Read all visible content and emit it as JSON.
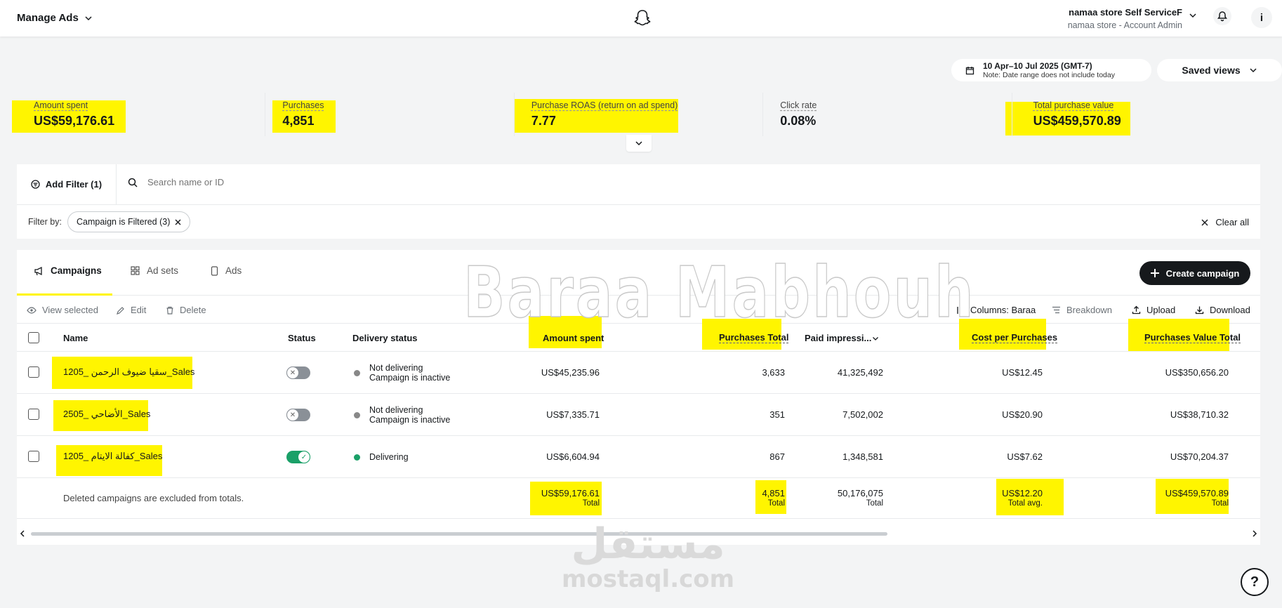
{
  "header": {
    "app_title": "Manage Ads",
    "account_name": "namaa store Self ServiceF",
    "account_role": "namaa store - Account Admin",
    "info_label": "i"
  },
  "date_range": {
    "label": "10 Apr–10 Jul 2025 (GMT-7)",
    "note": "Note: Date range does not include today"
  },
  "saved_views_label": "Saved views",
  "kpis": [
    {
      "label": "Amount spent",
      "value": "US$59,176.61"
    },
    {
      "label": "Purchases",
      "value": "4,851"
    },
    {
      "label": "Purchase ROAS (return on ad spend)",
      "value": "7.77"
    },
    {
      "label": "Click rate",
      "value": "0.08%"
    },
    {
      "label": "Total purchase value",
      "value": "US$459,570.89"
    }
  ],
  "filters": {
    "add_filter_label": "Add Filter (1)",
    "search_placeholder": "Search name or ID",
    "filter_by_label": "Filter by:",
    "chip_label": "Campaign is Filtered (3)",
    "clear_all_label": "Clear all"
  },
  "tabs": [
    {
      "label": "Campaigns"
    },
    {
      "label": "Ad sets"
    },
    {
      "label": "Ads"
    }
  ],
  "create_campaign_label": "Create campaign",
  "toolbar": {
    "view_selected": "View selected",
    "edit": "Edit",
    "delete": "Delete",
    "columns": "Columns: Baraa",
    "breakdown": "Breakdown",
    "upload": "Upload",
    "download": "Download"
  },
  "table": {
    "headers": {
      "name": "Name",
      "status": "Status",
      "delivery_status": "Delivery status",
      "amount_spent": "Amount spent",
      "purchases_total": "Purchases Total",
      "paid_impressions": "Paid impressi...",
      "cost_per_purchases": "Cost per Purchases",
      "purchases_value_total": "Purchases Value Total"
    },
    "rows": [
      {
        "name": "سقيا ضيوف الرحمن _1205_Sales",
        "delivery_main": "Not delivering",
        "delivery_sub": "Campaign is inactive",
        "amount_spent": "US$45,235.96",
        "purchases": "3,633",
        "impressions": "41,325,492",
        "cost_per": "US$12.45",
        "value_total": "US$350,656.20"
      },
      {
        "name": "الأضاحي _2505_Sales",
        "delivery_main": "Not delivering",
        "delivery_sub": "Campaign is inactive",
        "amount_spent": "US$7,335.71",
        "purchases": "351",
        "impressions": "7,502,002",
        "cost_per": "US$20.90",
        "value_total": "US$38,710.32"
      },
      {
        "name": "كفالة الايتام _1205_Sales",
        "delivery_main": "Delivering",
        "delivery_sub": "",
        "amount_spent": "US$6,604.94",
        "purchases": "867",
        "impressions": "1,348,581",
        "cost_per": "US$7.62",
        "value_total": "US$70,204.37"
      }
    ],
    "totals": {
      "note": "Deleted campaigns are excluded from totals.",
      "amount_spent": "US$59,176.61",
      "amount_spent_sub": "Total",
      "purchases": "4,851",
      "purchases_sub": "Total",
      "impressions": "50,176,075",
      "impressions_sub": "Total",
      "cost_per": "US$12.20",
      "cost_per_sub": "Total avg.",
      "value_total": "US$459,570.89",
      "value_total_sub": "Total"
    }
  },
  "watermarks": {
    "author": "Baraa Mabhouh",
    "site_ar": "مستقل",
    "site_en": "mostaql.com"
  },
  "help_label": "?",
  "colors": {
    "highlight": "#fff500",
    "toggle_on": "#1aa068",
    "primary_dark": "#16191c"
  }
}
